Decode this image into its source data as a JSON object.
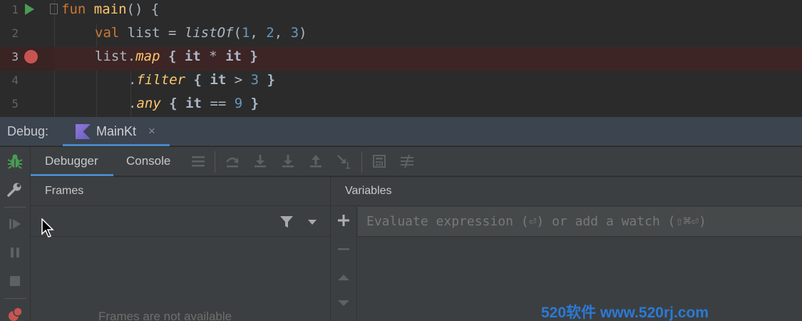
{
  "editor": {
    "lines": [
      {
        "number": "1"
      },
      {
        "number": "2"
      },
      {
        "number": "3"
      },
      {
        "number": "4"
      },
      {
        "number": "5"
      }
    ],
    "tokens": {
      "l1_kw": "fun",
      "l1_name": "main",
      "l1_rest": "() {",
      "l2_kw": "val",
      "l2_a": " list = ",
      "l2_fn": "listOf",
      "l2_b": "(",
      "l2_n1": "1",
      "l2_c": ", ",
      "l2_n2": "2",
      "l2_d": ", ",
      "l2_n3": "3",
      "l2_e": ")",
      "l3_a": "list.",
      "l3_fn": "map",
      "l3_b": " { ",
      "l3_it1": "it",
      "l3_c": " * ",
      "l3_it2": "it",
      "l3_d": " }",
      "l4_a": ".",
      "l4_fn": "filter",
      "l4_b": " { ",
      "l4_it": "it",
      "l4_c": " > ",
      "l4_n": "3",
      "l4_d": " }",
      "l5_a": ".",
      "l5_fn": "any",
      "l5_b": " { ",
      "l5_it": "it",
      "l5_c": " == ",
      "l5_n": "9",
      "l5_d": " }"
    }
  },
  "debug": {
    "label": "Debug:",
    "session_tab": "MainKt",
    "close_glyph": "×"
  },
  "tabs": {
    "debugger": "Debugger",
    "console": "Console"
  },
  "frames": {
    "title": "Frames",
    "empty_text": "Frames are not available"
  },
  "variables": {
    "title": "Variables",
    "evaluate_placeholder": "Evaluate expression (⏎) or add a watch (⇧⌘⏎)"
  },
  "watermark": "520软件 www.520rj.com",
  "colors": {
    "accent": "#4a88c7",
    "breakpoint": "#c75450",
    "run": "#499c54",
    "bug": "#499c54"
  }
}
